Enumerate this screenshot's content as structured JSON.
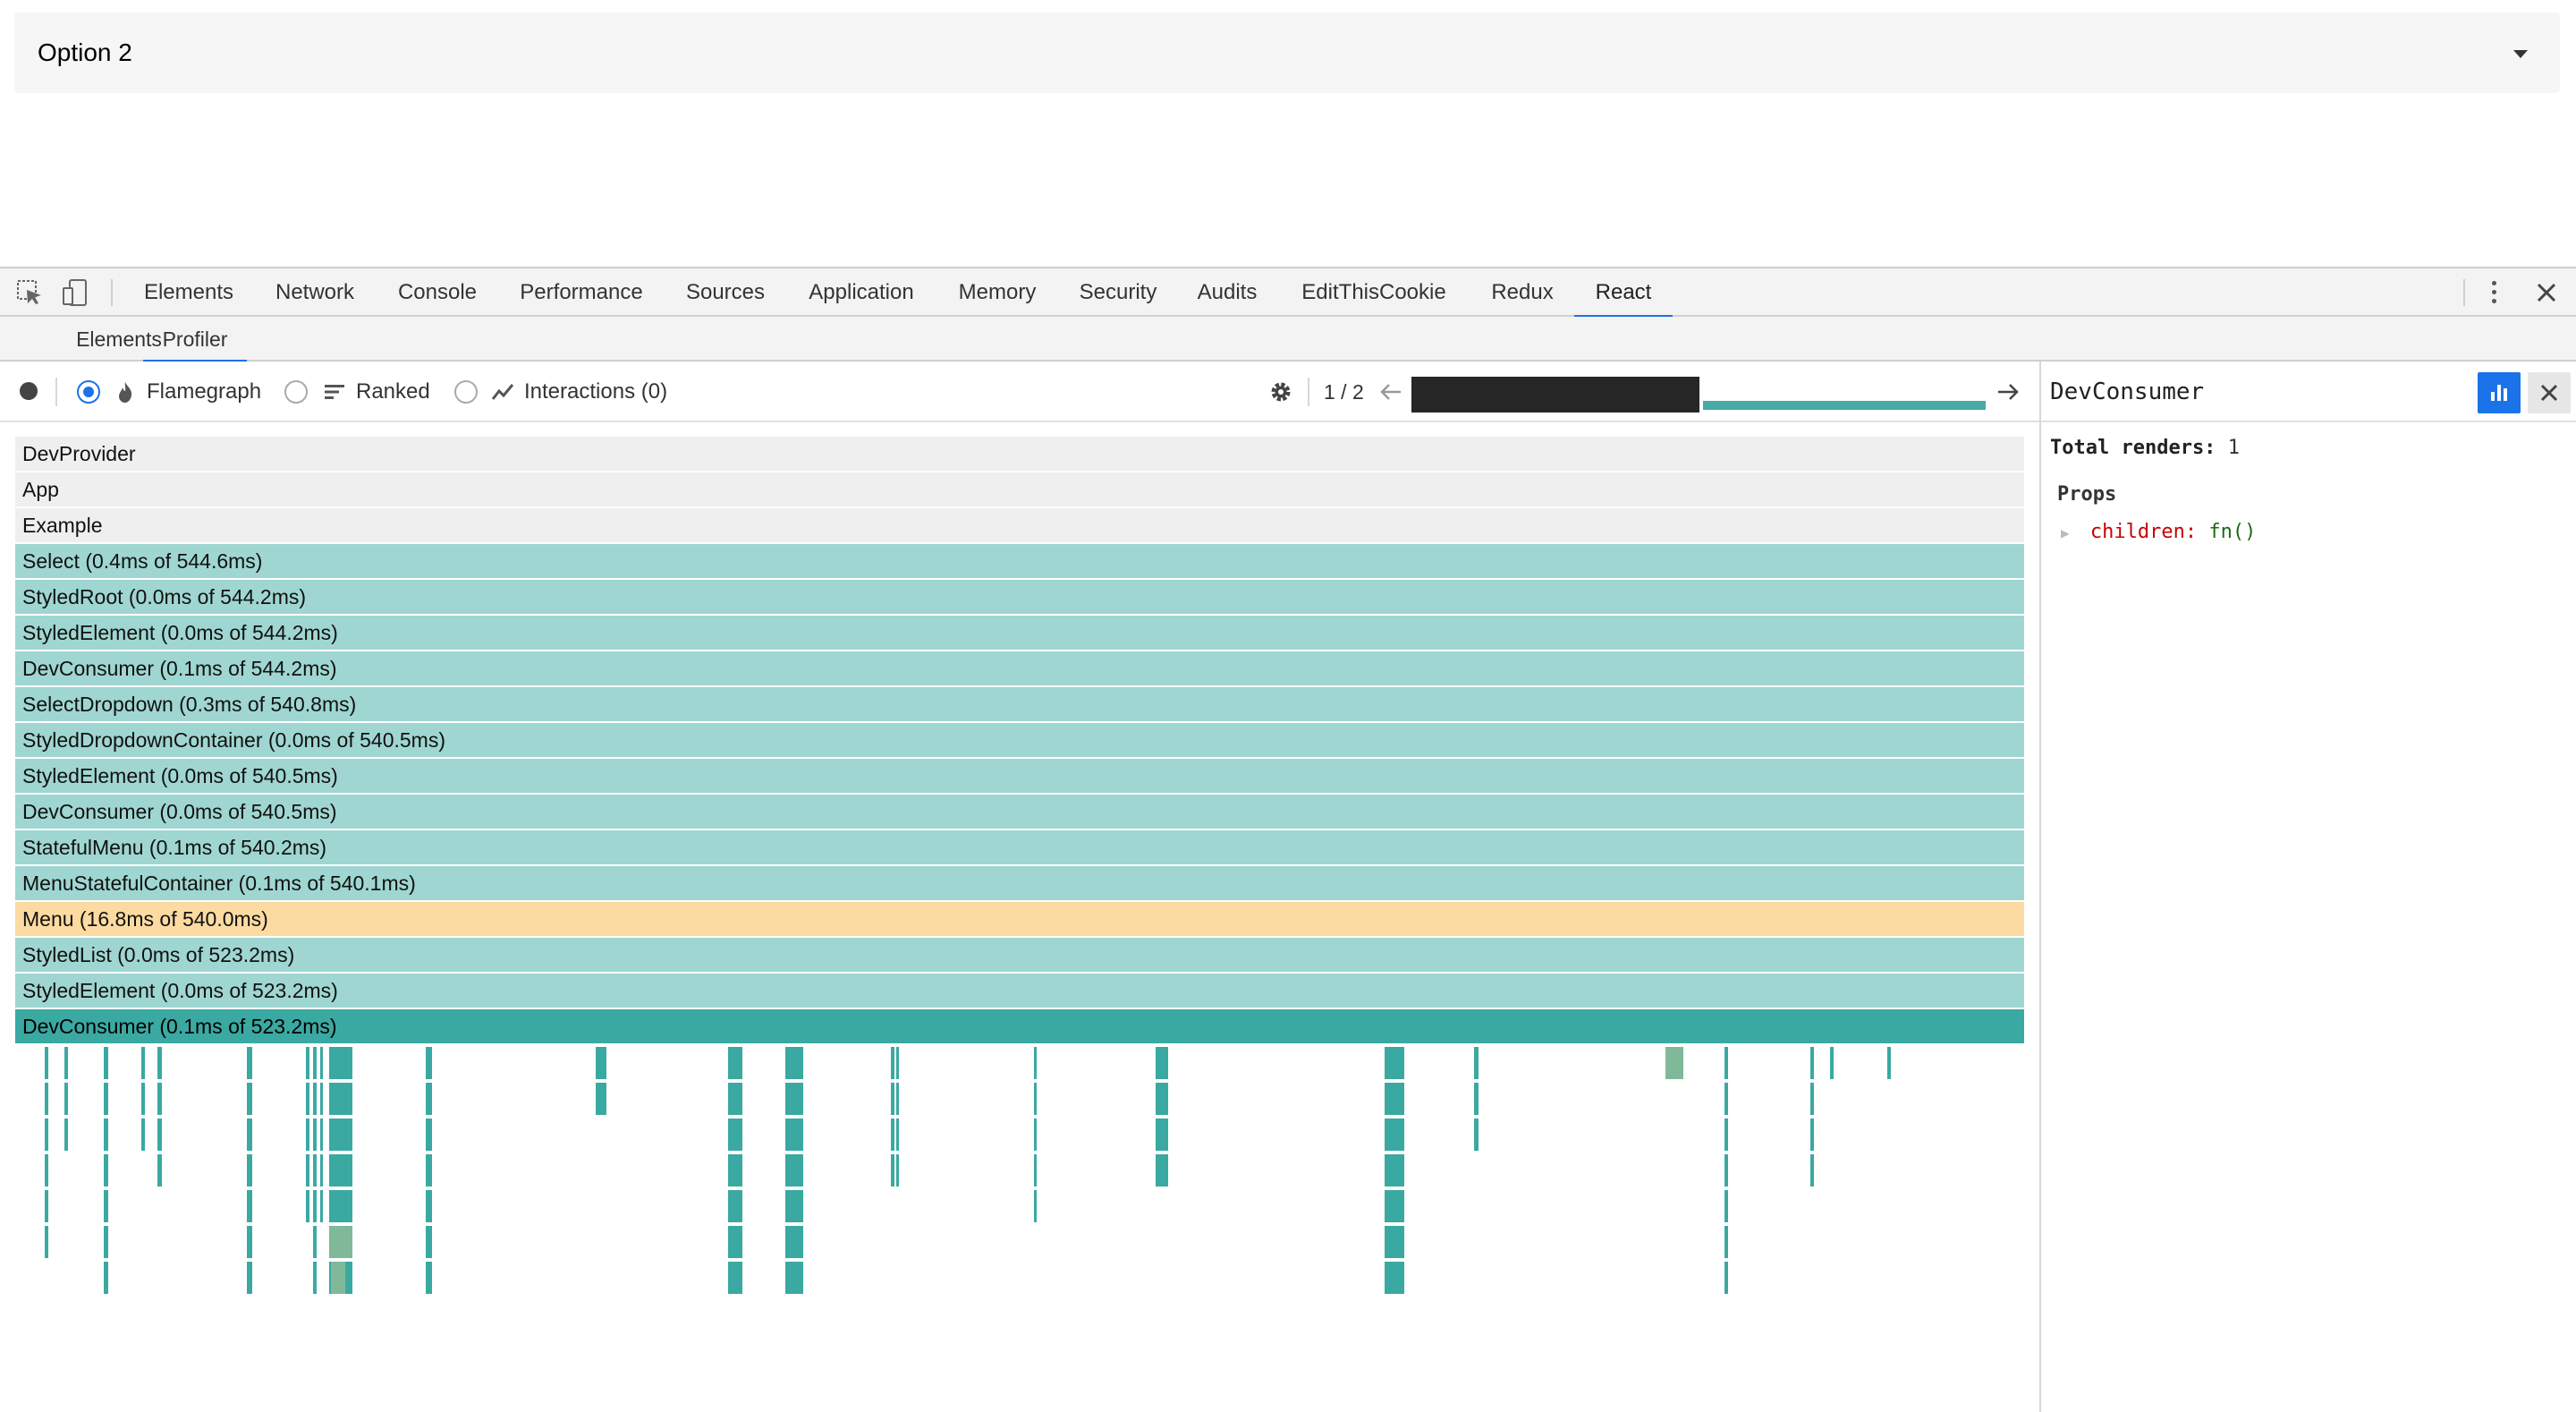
{
  "select": {
    "value": "Option 2"
  },
  "devtools": {
    "tabs": [
      "Elements",
      "Network",
      "Console",
      "Performance",
      "Sources",
      "Application",
      "Memory",
      "Security",
      "Audits",
      "EditThisCookie",
      "Redux",
      "React"
    ],
    "active_tab": "React",
    "sub_tabs": [
      "Elements",
      "Profiler"
    ],
    "active_sub_tab": "Profiler"
  },
  "profiler": {
    "modes": [
      {
        "label": "Flamegraph",
        "checked": true
      },
      {
        "label": "Ranked",
        "checked": false
      },
      {
        "label": "Interactions (0)",
        "checked": false
      }
    ],
    "commit_position": "1 / 2"
  },
  "flamegraph": {
    "rows": [
      {
        "label": "DevProvider",
        "kind": "grey"
      },
      {
        "label": "App",
        "kind": "grey"
      },
      {
        "label": "Example",
        "kind": "grey"
      },
      {
        "label": "Select (0.4ms of 544.6ms)",
        "kind": "teal"
      },
      {
        "label": "StyledRoot (0.0ms of 544.2ms)",
        "kind": "teal"
      },
      {
        "label": "StyledElement (0.0ms of 544.2ms)",
        "kind": "teal"
      },
      {
        "label": "DevConsumer (0.1ms of 544.2ms)",
        "kind": "teal"
      },
      {
        "label": "SelectDropdown (0.3ms of 540.8ms)",
        "kind": "teal"
      },
      {
        "label": "StyledDropdownContainer (0.0ms of 540.5ms)",
        "kind": "teal"
      },
      {
        "label": "StyledElement (0.0ms of 540.5ms)",
        "kind": "teal"
      },
      {
        "label": "DevConsumer (0.0ms of 540.5ms)",
        "kind": "teal"
      },
      {
        "label": "StatefulMenu (0.1ms of 540.2ms)",
        "kind": "teal"
      },
      {
        "label": "MenuStatefulContainer (0.1ms of 540.1ms)",
        "kind": "teal"
      },
      {
        "label": "Menu (16.8ms of 540.0ms)",
        "kind": "orange"
      },
      {
        "label": "StyledList (0.0ms of 523.2ms)",
        "kind": "teal"
      },
      {
        "label": "StyledElement (0.0ms of 523.2ms)",
        "kind": "teal"
      },
      {
        "label": "DevConsumer (0.1ms of 523.2ms)",
        "kind": "selected"
      }
    ]
  },
  "side_panel": {
    "title": "DevConsumer",
    "renders_label": "Total renders:",
    "renders_value": "1",
    "props_heading": "Props",
    "props": [
      {
        "key": "children:",
        "value": "fn()"
      }
    ]
  }
}
